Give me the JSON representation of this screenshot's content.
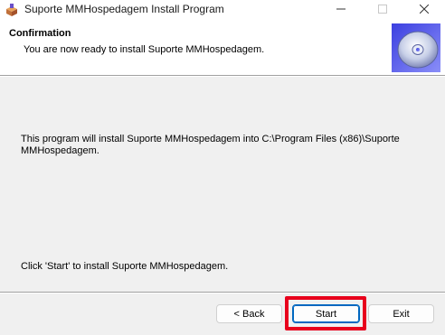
{
  "window": {
    "title": "Suporte MMHospedagem Install Program",
    "icon": "installer-box-icon",
    "controls": {
      "minimize": "minimize-icon",
      "maximize": "maximize-icon",
      "close": "close-icon"
    }
  },
  "header": {
    "title": "Confirmation",
    "subtitle": "You are now ready to install Suporte MMHospedagem.",
    "icon": "cd-disc-icon"
  },
  "body": {
    "install_text": "This program will install Suporte MMHospedagem into C:\\Program Files (x86)\\Suporte MMHospedagem.",
    "click_text": "Click 'Start' to install Suporte MMHospedagem."
  },
  "buttons": {
    "back": "< Back",
    "start": "Start",
    "exit": "Exit"
  },
  "colors": {
    "highlight": "#e8001c",
    "default_button_border": "#0067c0",
    "dialog_background": "#f0f0f0"
  }
}
